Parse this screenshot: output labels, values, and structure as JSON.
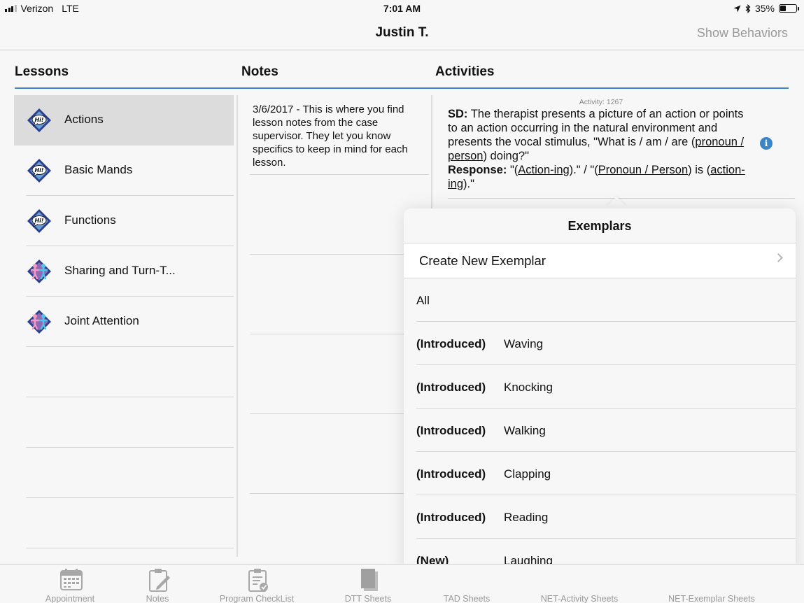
{
  "status_bar": {
    "carrier": "Verizon",
    "network": "LTE",
    "time": "7:01 AM",
    "battery": "35%",
    "battery_level": 0.35
  },
  "nav": {
    "title": "Justin T.",
    "action": "Show Behaviors"
  },
  "columns": {
    "lessons": "Lessons",
    "notes": "Notes",
    "activities": "Activities"
  },
  "lessons": [
    {
      "label": "Actions",
      "icon": "hi-speech-icon",
      "selected": true
    },
    {
      "label": "Basic Mands",
      "icon": "hi-speech-icon"
    },
    {
      "label": "Functions",
      "icon": "hi-speech-icon"
    },
    {
      "label": "Sharing and Turn-T...",
      "icon": "people-icon"
    },
    {
      "label": "Joint Attention",
      "icon": "people-icon"
    }
  ],
  "notes": {
    "text": "3/6/2017 - This is where you find lesson notes from the case supervisor. They let you know specifics to keep in mind for each lesson."
  },
  "activity": {
    "id_label": "Activity: 1267",
    "sd_label": "SD:",
    "sd_text_1": " The therapist presents a picture of an action or points to an action occurring in the natural environment and presents the vocal stimulus, \"What is / am / are (",
    "sd_u_1": "pronoun / person",
    "sd_text_2": ") doing?\"",
    "response_label": "Response:",
    "resp_text_1": " \"(",
    "resp_u_1": "Action-ing",
    "resp_text_2": ").\" / \"(",
    "resp_u_2": "Pronoun / Person",
    "resp_text_3": ") is (",
    "resp_u_3": "action-ing",
    "resp_text_4": ").\"",
    "info_glyph": "i"
  },
  "exemplars": {
    "title": "Exemplars",
    "create_label": "Create New Exemplar",
    "all_label": "All",
    "items": [
      {
        "status": "(Introduced)",
        "name": "Waving"
      },
      {
        "status": "(Introduced)",
        "name": "Knocking"
      },
      {
        "status": "(Introduced)",
        "name": "Walking"
      },
      {
        "status": "(Introduced)",
        "name": "Clapping"
      },
      {
        "status": "(Introduced)",
        "name": "Reading"
      },
      {
        "status": "(New)",
        "name": "Laughing"
      }
    ]
  },
  "tabs": [
    {
      "label": "Appointment",
      "icon": "calendar-icon"
    },
    {
      "label": "Notes",
      "icon": "notepad-icon"
    },
    {
      "label": "Program CheckList",
      "icon": "checklist-icon"
    },
    {
      "label": "DTT Sheets",
      "icon": "sheets-icon"
    },
    {
      "label": "TAD Sheets",
      "icon": "sheets-icon"
    },
    {
      "label": "NET-Activity Sheets",
      "icon": "sheets-icon"
    },
    {
      "label": "NET-Exemplar Sheets",
      "icon": "sheets-icon"
    }
  ],
  "colors": {
    "accent": "#3d86c6",
    "selected_row": "#dcdcdc",
    "muted_text": "#9a9a9a"
  }
}
